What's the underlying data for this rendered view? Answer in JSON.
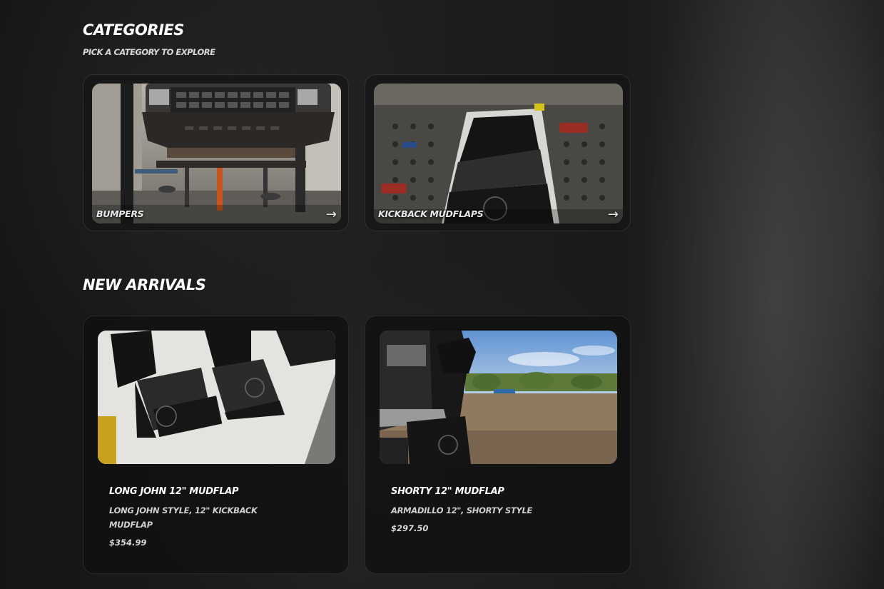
{
  "categories": {
    "title": "CATEGORIES",
    "subtitle": "PICK A CATEGORY TO EXPLORE",
    "items": [
      {
        "label": "BUMPERS",
        "arrow": "→",
        "icon": "arrow-right-icon"
      },
      {
        "label": "KICKBACK MUDFLAPS",
        "arrow": "→",
        "icon": "arrow-right-icon"
      }
    ]
  },
  "new_arrivals": {
    "title": "NEW ARRIVALS",
    "products": [
      {
        "name": "LONG JOHN 12\" MUDFLAP",
        "description": "LONG JOHN STYLE, 12\" KICKBACK MUDFLAP",
        "price": "$354.99"
      },
      {
        "name": "SHORTY 12\" MUDFLAP",
        "description": "ARMADILLO 12\", SHORTY STYLE",
        "price": "$297.50"
      }
    ]
  },
  "colors": {
    "background": "#1a1a1a",
    "card_background": "#121212",
    "text": "#ffffff",
    "muted_text": "#cfcfcf"
  }
}
